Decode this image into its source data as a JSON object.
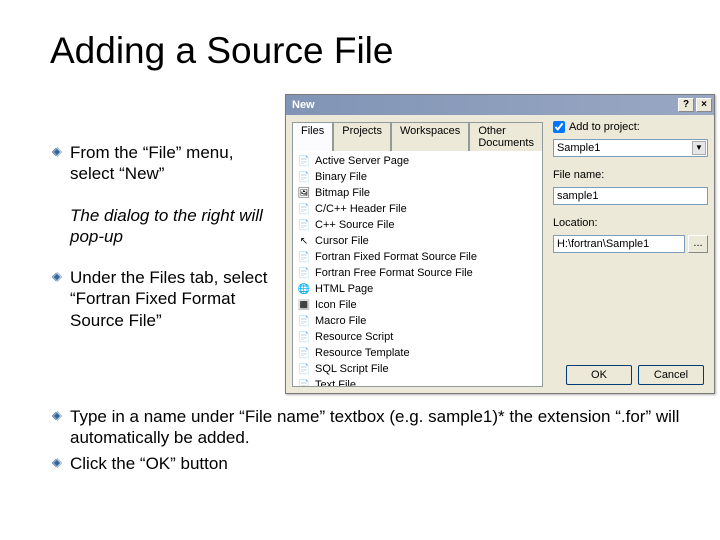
{
  "slide": {
    "title": "Adding a Source File",
    "bullets_left": [
      "From the “File” menu, select “New”",
      "Under the Files tab, select “Fortran Fixed Format Source File”"
    ],
    "italic_note": "The dialog to the right will pop-up",
    "bullets_bottom": [
      "Type in a name under “File name” textbox (e.g. sample1)* the extension “.for” will automatically be added.",
      "Click the “OK” button"
    ]
  },
  "dialog": {
    "title": "New",
    "help_btn": "?",
    "close_btn": "×",
    "tabs": [
      "Files",
      "Projects",
      "Workspaces",
      "Other Documents"
    ],
    "active_tab": "Files",
    "file_types": [
      "Active Server Page",
      "Binary File",
      "Bitmap File",
      "C/C++ Header File",
      "C++ Source File",
      "Cursor File",
      "Fortran Fixed Format Source File",
      "Fortran Free Format Source File",
      "HTML Page",
      "Icon File",
      "Macro File",
      "Resource Script",
      "Resource Template",
      "SQL Script File",
      "Text File"
    ],
    "add_to_project_label": "Add to project:",
    "add_to_project_checked": true,
    "project_name": "Sample1",
    "file_name_label": "File name:",
    "file_name_value": "sample1",
    "location_label": "Location:",
    "location_value": "H:\\fortran\\Sample1",
    "browse_label": "...",
    "ok_label": "OK",
    "cancel_label": "Cancel"
  }
}
